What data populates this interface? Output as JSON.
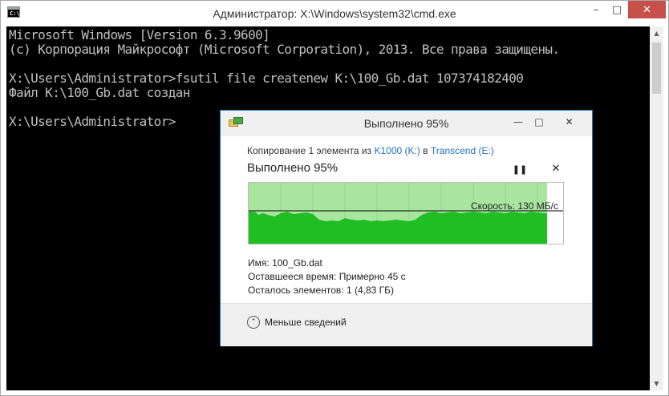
{
  "cmd": {
    "title": "Администратор: X:\\Windows\\system32\\cmd.exe",
    "icon_text": "C:\\_",
    "min_label": "–",
    "max_label": "□",
    "close_label": "✕",
    "lines": [
      "Microsoft Windows [Version 6.3.9600]",
      "(c) Корпорация Майкрософт (Microsoft Corporation), 2013. Все права защищены.",
      "",
      "X:\\Users\\Administrator>fsutil file createnew K:\\100_Gb.dat 107374182400",
      "Файл K:\\100_Gb.dat создан",
      "",
      "X:\\Users\\Administrator>"
    ],
    "scroll_up": "▲",
    "scroll_down": "▼"
  },
  "dialog": {
    "title": "Выполнено 95%",
    "min_label": "—",
    "max_label": "□",
    "close_label": "✕",
    "copying": {
      "prefix": "Копирование 1 элемента из ",
      "source": "K1000 (K:)",
      "middle": " в ",
      "dest": "Transcend (E:)"
    },
    "progress_title": "Выполнено 95%",
    "pause_label": "❚❚",
    "stop_label": "✕",
    "progress_percent": 95,
    "speed_label": "Скорость: 130 МБ/с",
    "info": {
      "name_key": "Имя:",
      "name_val": "100_Gb.dat",
      "time_key": "Оставшееся время:",
      "time_val": "Примерно 45 с",
      "items_key": "Осталось элементов:",
      "items_val": "1 (4,83 ГБ)"
    },
    "less_label": "Меньше сведений",
    "less_icon": "⌃"
  },
  "colors": {
    "console_bg": "#000000",
    "console_text": "#c0c0c0",
    "progress_fill": "#a8e6a0",
    "speed_fill": "#1fbf23",
    "link": "#1f6fbf",
    "dialog_border": "#1979ca",
    "close_red": "#c7504b"
  }
}
